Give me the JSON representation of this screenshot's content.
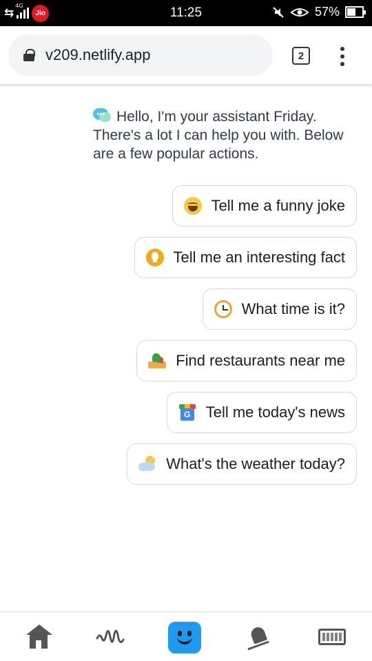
{
  "status_bar": {
    "network": "4G",
    "carrier": "Jio",
    "time": "11:25",
    "battery": "57%",
    "battery_level": 0.57
  },
  "browser": {
    "url": "v209.netlify.app",
    "tab_count": "2"
  },
  "greeting": {
    "icon": "chat-bubbles-icon",
    "text": "Hello, I'm your assistant Friday. There's a lot I can help you with. Below are a few popular actions."
  },
  "actions": [
    {
      "label": "Tell me a funny joke",
      "icon": "laughing-face-icon"
    },
    {
      "label": "Tell me an interesting fact",
      "icon": "lightbulb-icon"
    },
    {
      "label": "What time is it?",
      "icon": "clock-icon"
    },
    {
      "label": "Find restaurants near me",
      "icon": "food-icon"
    },
    {
      "label": "Tell me today's news",
      "icon": "google-news-icon"
    },
    {
      "label": "What's the weather today?",
      "icon": "sun-cloud-icon"
    }
  ],
  "bottom_nav": [
    "home-icon",
    "waveform-icon",
    "assistant-face-icon",
    "bell-muted-icon",
    "keyboard-icon"
  ]
}
